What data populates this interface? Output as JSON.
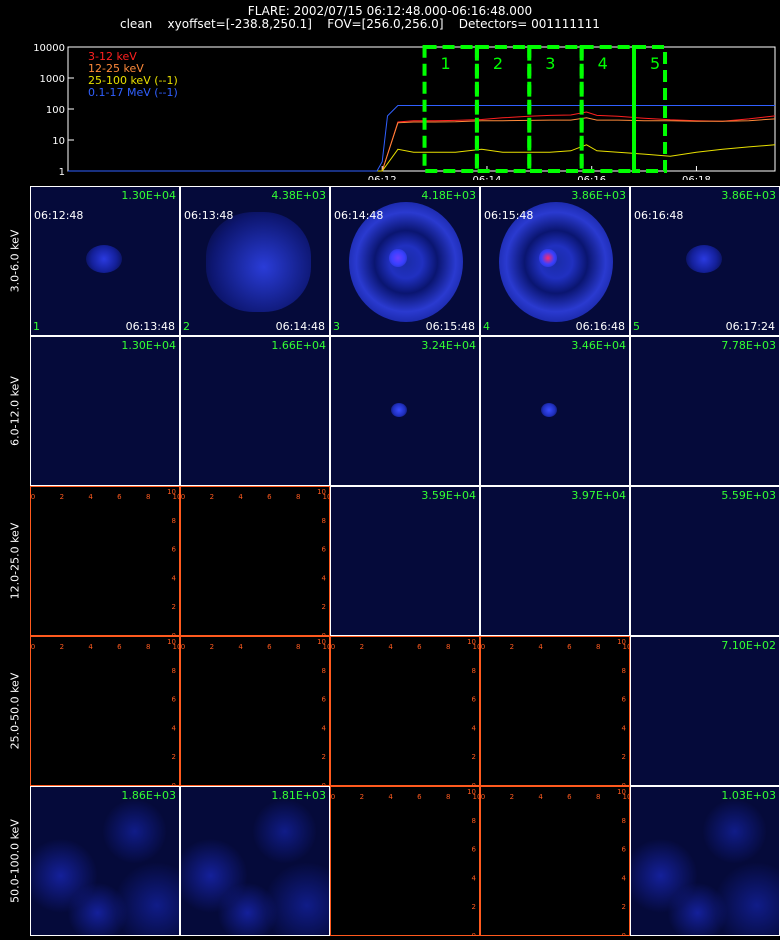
{
  "header": {
    "flare_line": "FLARE: 2002/07/15 06:12:48.000-06:16:48.000",
    "params_line": "clean    xyoffset=[-238.8,250.1]    FOV=[256.0,256.0]    Detectors= 001111111"
  },
  "colors": {
    "3-12": "#ff2020",
    "12-25": "#ff8a3a",
    "25-100": "#e8e000",
    "0.1-17": "#3060ff",
    "interval_box": "#00ff00",
    "panel_grid": "#ffffff",
    "empty_axis": "#ff5a1e",
    "peak_text": "#33ff33"
  },
  "chart_data": {
    "type": "line",
    "title": "",
    "xlabel": "",
    "ylabel": "",
    "log_y": true,
    "ylim": [
      1,
      10000
    ],
    "y_ticks": [
      "1",
      "10",
      "100",
      "1000",
      "10000"
    ],
    "xlim_minutes": [
      6.0,
      19.5
    ],
    "x_ticks": [
      "06:12",
      "06:14",
      "06:16",
      "06:18"
    ],
    "x_tick_minutes": [
      12,
      14,
      16,
      18
    ],
    "legend": [
      "3-12 keV",
      "12-25 keV",
      "25-100 keV (--1)",
      "0.1-17 MeV (--1)"
    ],
    "legend_placement": "top-left",
    "intervals": [
      {
        "label": "1",
        "start_min": 12.808,
        "end_min": 13.808
      },
      {
        "label": "2",
        "start_min": 13.808,
        "end_min": 14.808
      },
      {
        "label": "3",
        "start_min": 14.808,
        "end_min": 15.808
      },
      {
        "label": "4",
        "start_min": 15.808,
        "end_min": 16.808
      },
      {
        "label": "5",
        "start_min": 16.808,
        "end_min": 17.4
      }
    ],
    "series": [
      {
        "name": "3-12 keV",
        "key": "3-12",
        "x": [
          6.0,
          11.9,
          12.0,
          12.3,
          12.6,
          13.0,
          13.4,
          13.9,
          14.3,
          14.8,
          15.2,
          15.6,
          15.9,
          16.1,
          16.5,
          17.0,
          17.5,
          18.0,
          18.5,
          19.0,
          19.5
        ],
        "values": [
          1,
          1,
          1,
          38,
          42,
          42,
          43,
          46,
          52,
          58,
          62,
          64,
          80,
          62,
          58,
          50,
          45,
          42,
          40,
          48,
          60
        ]
      },
      {
        "name": "12-25 keV",
        "key": "12-25",
        "x": [
          6.0,
          11.9,
          12.0,
          12.3,
          12.6,
          13.0,
          13.4,
          13.9,
          14.3,
          14.8,
          15.2,
          15.6,
          15.9,
          16.1,
          16.5,
          17.0,
          17.5,
          18.0,
          18.5,
          19.0,
          19.5
        ],
        "values": [
          1,
          1,
          1,
          36,
          38,
          38,
          39,
          42,
          42,
          43,
          44,
          44,
          52,
          44,
          44,
          42,
          42,
          40,
          40,
          42,
          48
        ]
      },
      {
        "name": "25-100 keV (--1)",
        "key": "25-100",
        "x": [
          6.0,
          11.9,
          12.0,
          12.3,
          12.6,
          13.0,
          13.4,
          13.9,
          14.3,
          14.8,
          15.2,
          15.6,
          15.9,
          16.1,
          16.5,
          17.0,
          17.5,
          18.0,
          18.5,
          19.0,
          19.5
        ],
        "values": [
          1,
          1,
          1,
          5,
          4,
          4,
          4,
          5,
          4,
          4,
          4,
          4.5,
          7,
          4.5,
          4,
          3.5,
          3,
          4,
          5,
          6,
          7
        ]
      },
      {
        "name": "0.1-17 MeV (--1)",
        "key": "0.1-17",
        "x": [
          6.0,
          11.9,
          12.0,
          12.1,
          12.3,
          13.0,
          14.0,
          15.0,
          16.0,
          17.0,
          18.0,
          19.0,
          19.5
        ],
        "values": [
          1,
          1,
          2,
          60,
          130,
          130,
          130,
          130,
          130,
          130,
          130,
          130,
          130
        ]
      }
    ]
  },
  "grid": {
    "energy_bands": [
      "3.0-6.0 keV",
      "6.0-12.0 keV",
      "12.0-25.0 keV",
      "25.0-50.0 keV",
      "50.0-100.0 keV"
    ],
    "panels": [
      [
        {
          "kind": "image",
          "peak": "1.30E+04",
          "t_start": "06:12:48",
          "t_end": "06:13:48",
          "index": "1",
          "source": "faint"
        },
        {
          "kind": "image",
          "peak": "4.38E+03",
          "t_start": "06:13:48",
          "t_end": "06:14:48",
          "index": "2",
          "source": "mottled"
        },
        {
          "kind": "image",
          "peak": "4.18E+03",
          "t_start": "06:14:48",
          "t_end": "06:15:48",
          "index": "3",
          "source": "ring"
        },
        {
          "kind": "image",
          "peak": "3.86E+03",
          "t_start": "06:15:48",
          "t_end": "06:16:48",
          "index": "4",
          "source": "ring2"
        },
        {
          "kind": "image",
          "peak": "3.86E+03",
          "t_start": "06:16:48",
          "t_end": "06:17:24",
          "index": "5",
          "source": "faint"
        }
      ],
      [
        {
          "kind": "image",
          "peak": "1.30E+04",
          "source": "none"
        },
        {
          "kind": "image",
          "peak": "1.66E+04",
          "source": "none"
        },
        {
          "kind": "image",
          "peak": "3.24E+04",
          "source": "dot"
        },
        {
          "kind": "image",
          "peak": "3.46E+04",
          "source": "dot"
        },
        {
          "kind": "image",
          "peak": "7.78E+03",
          "source": "none"
        }
      ],
      [
        {
          "kind": "empty"
        },
        {
          "kind": "empty"
        },
        {
          "kind": "image",
          "peak": "3.59E+04",
          "source": "none"
        },
        {
          "kind": "image",
          "peak": "3.97E+04",
          "source": "none"
        },
        {
          "kind": "image",
          "peak": "5.59E+03",
          "source": "none"
        }
      ],
      [
        {
          "kind": "empty"
        },
        {
          "kind": "empty"
        },
        {
          "kind": "empty"
        },
        {
          "kind": "empty"
        },
        {
          "kind": "image",
          "peak": "7.10E+02",
          "source": "none"
        }
      ],
      [
        {
          "kind": "image",
          "peak": "1.86E+03",
          "source": "noise"
        },
        {
          "kind": "image",
          "peak": "1.81E+03",
          "source": "noise"
        },
        {
          "kind": "empty"
        },
        {
          "kind": "empty"
        },
        {
          "kind": "image",
          "peak": "1.03E+03",
          "source": "noise"
        }
      ]
    ],
    "empty_axis_ticks": [
      "0",
      "2",
      "4",
      "6",
      "8",
      "10"
    ]
  }
}
